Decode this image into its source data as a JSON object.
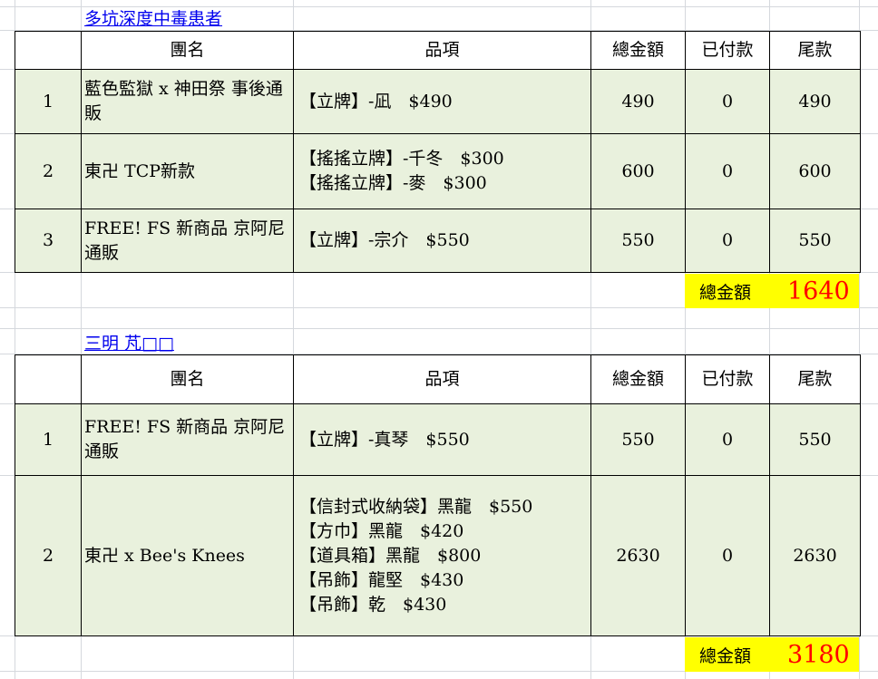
{
  "sheet": {
    "section1": {
      "title": "多坑深度中毒患者",
      "headers": [
        "團名",
        "品項",
        "總金額",
        "已付款",
        "尾款"
      ],
      "rows": [
        {
          "index": "1",
          "name": "藍色監獄 x 神田祭 事後通販",
          "items": [
            "【立牌】-凪　$490"
          ],
          "total": "490",
          "paid": "0",
          "balance": "490"
        },
        {
          "index": "2",
          "name": "東卍 TCP新款",
          "items": [
            "【搖搖立牌】-千冬　$300",
            "【搖搖立牌】-麥　$300"
          ],
          "total": "600",
          "paid": "0",
          "balance": "600"
        },
        {
          "index": "3",
          "name": "FREE! FS 新商品 京阿尼通販",
          "items": [
            "【立牌】-宗介　$550"
          ],
          "total": "550",
          "paid": "0",
          "balance": "550"
        }
      ],
      "total_label": "總金額",
      "total_value": "1640"
    },
    "section2": {
      "title": "三明 芃□□",
      "headers": [
        "團名",
        "品項",
        "總金額",
        "已付款",
        "尾款"
      ],
      "rows": [
        {
          "index": "1",
          "name": "FREE! FS 新商品 京阿尼通販",
          "items": [
            "【立牌】-真琴　$550"
          ],
          "total": "550",
          "paid": "0",
          "balance": "550"
        },
        {
          "index": "2",
          "name": "東卍 x Bee's Knees",
          "items": [
            "【信封式收納袋】黑龍　$550",
            "【方巾】黑龍　$420",
            "【道具箱】黑龍　$800",
            "【吊飾】龍堅　$430",
            "【吊飾】乾　$430"
          ],
          "total": "2630",
          "paid": "0",
          "balance": "2630"
        }
      ],
      "total_label": "總金額",
      "total_value": "3180"
    }
  },
  "colors": {
    "row_fill": "#e9f1dd",
    "total_fill": "#ffff00",
    "total_value": "#ff0000",
    "link": "#0000ee",
    "gridline": "#d5d8dd"
  }
}
